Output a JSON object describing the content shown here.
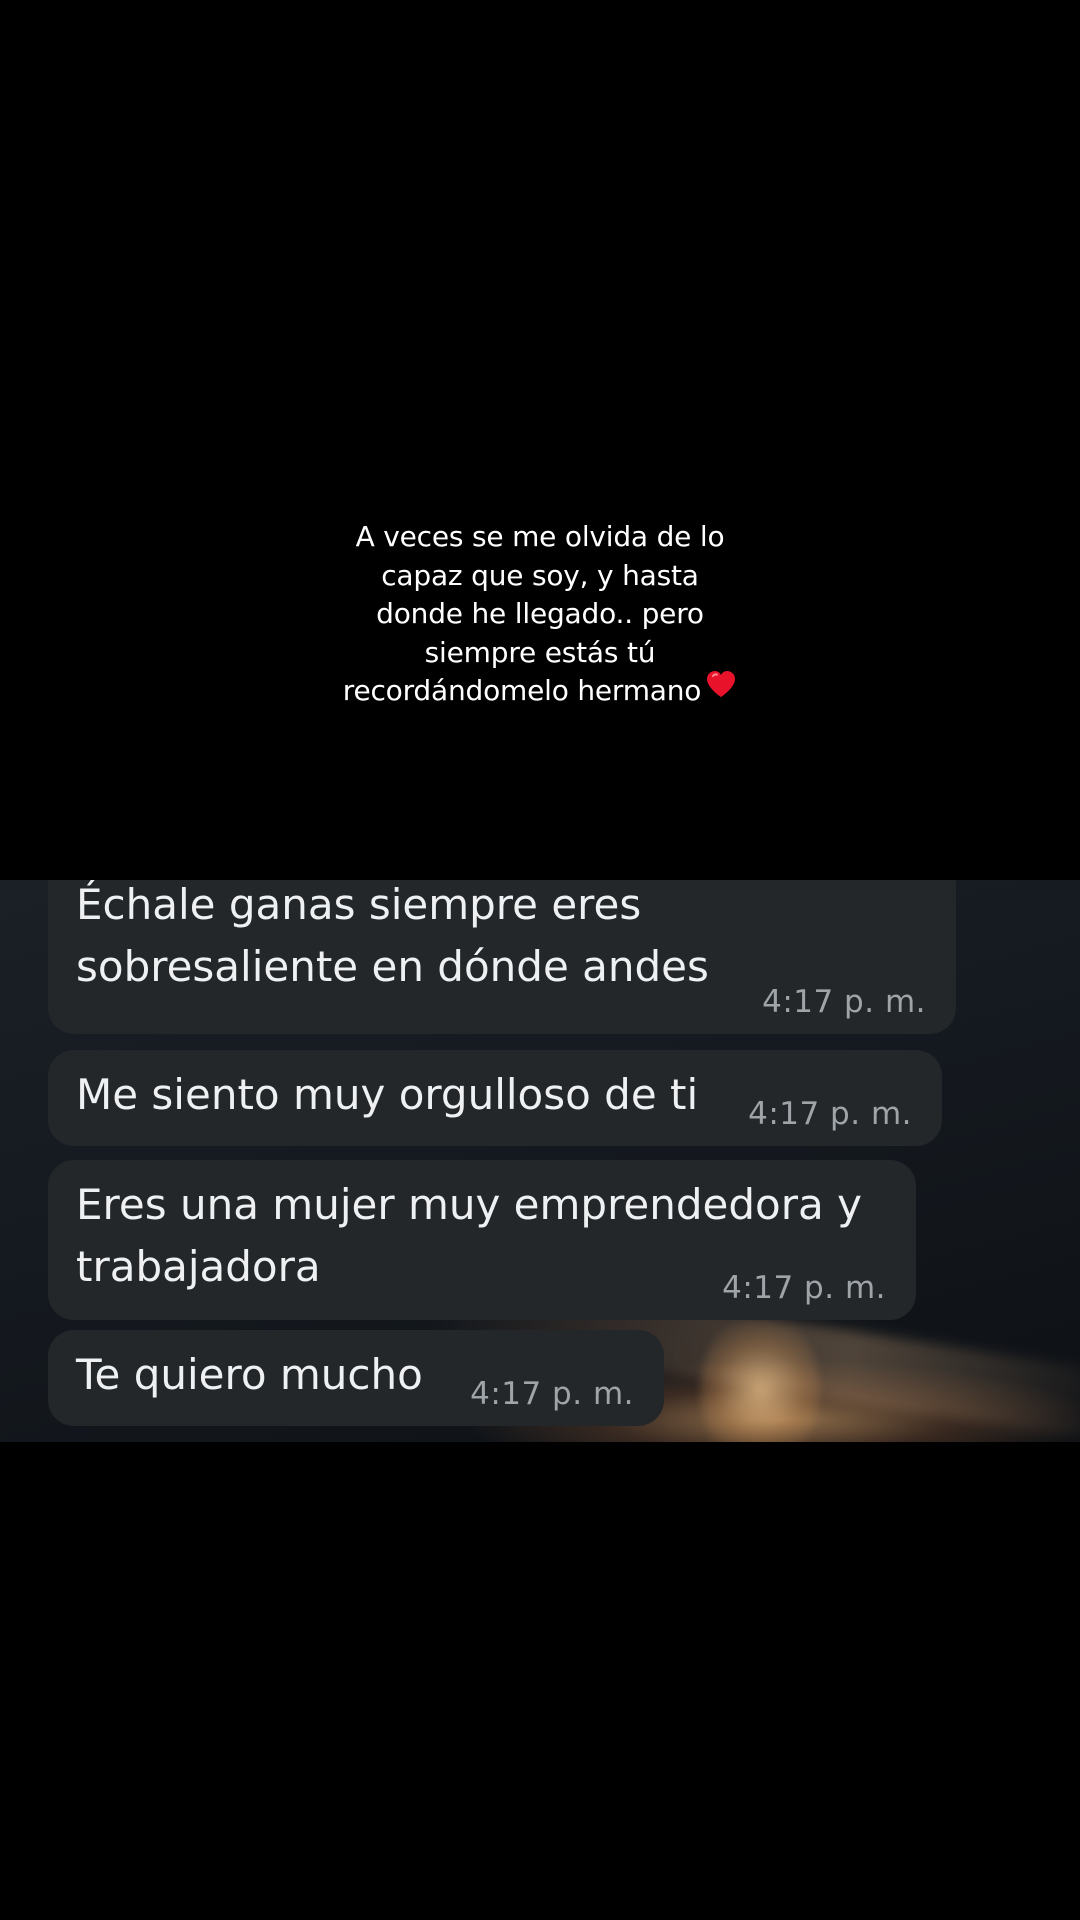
{
  "caption": {
    "lines": [
      "A veces se me olvida de lo",
      "capaz que soy, y hasta",
      "donde he llegado.. pero",
      "siempre estás tú",
      "recordándomelo hermano"
    ],
    "emoji": "heart-icon"
  },
  "messages": [
    {
      "text": "Échale ganas siempre eres\nsobresaliente en dónde andes",
      "time": "4:17 p. m."
    },
    {
      "text": "Me siento muy orgulloso de ti",
      "time": "4:17 p. m."
    },
    {
      "text": "Eres una mujer muy emprendedora y\ntrabajadora",
      "time": "4:17 p. m."
    },
    {
      "text": "Te quiero mucho",
      "time": "4:17 p. m."
    }
  ],
  "colors": {
    "background": "#000000",
    "bubble": "#23272a",
    "bubble_text": "#eef0f1",
    "timestamp": "#9fa4a8",
    "heart": "#e8132b"
  }
}
